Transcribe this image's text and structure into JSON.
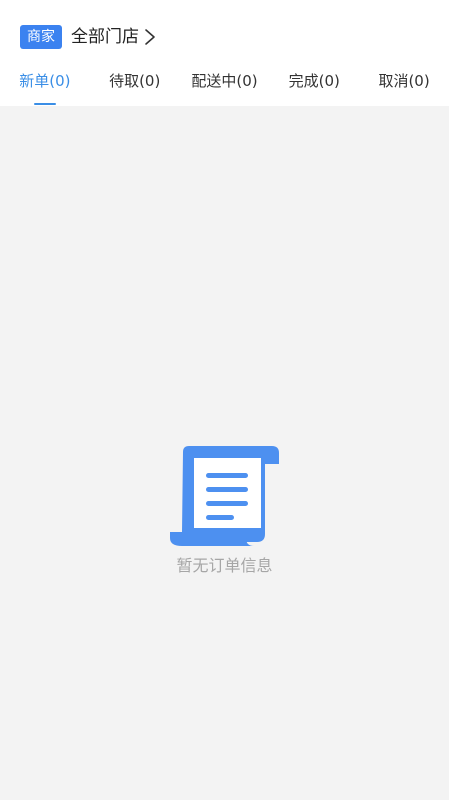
{
  "header": {
    "badge": "商家",
    "store": "全部门店"
  },
  "tabs": [
    {
      "label": "新单(0)"
    },
    {
      "label": "待取(0)"
    },
    {
      "label": "配送中(0)"
    },
    {
      "label": "完成(0)"
    },
    {
      "label": "取消(0)"
    }
  ],
  "active_tab_index": 0,
  "empty_state": {
    "message": "暂无订单信息",
    "icon": "receipt-scroll-icon"
  },
  "colors": {
    "accent": "#3a8ee6",
    "badge_bg": "#3b82f0",
    "icon": "#4d90f0",
    "content_bg": "#f3f3f3",
    "muted_text": "#a6a6a6"
  }
}
